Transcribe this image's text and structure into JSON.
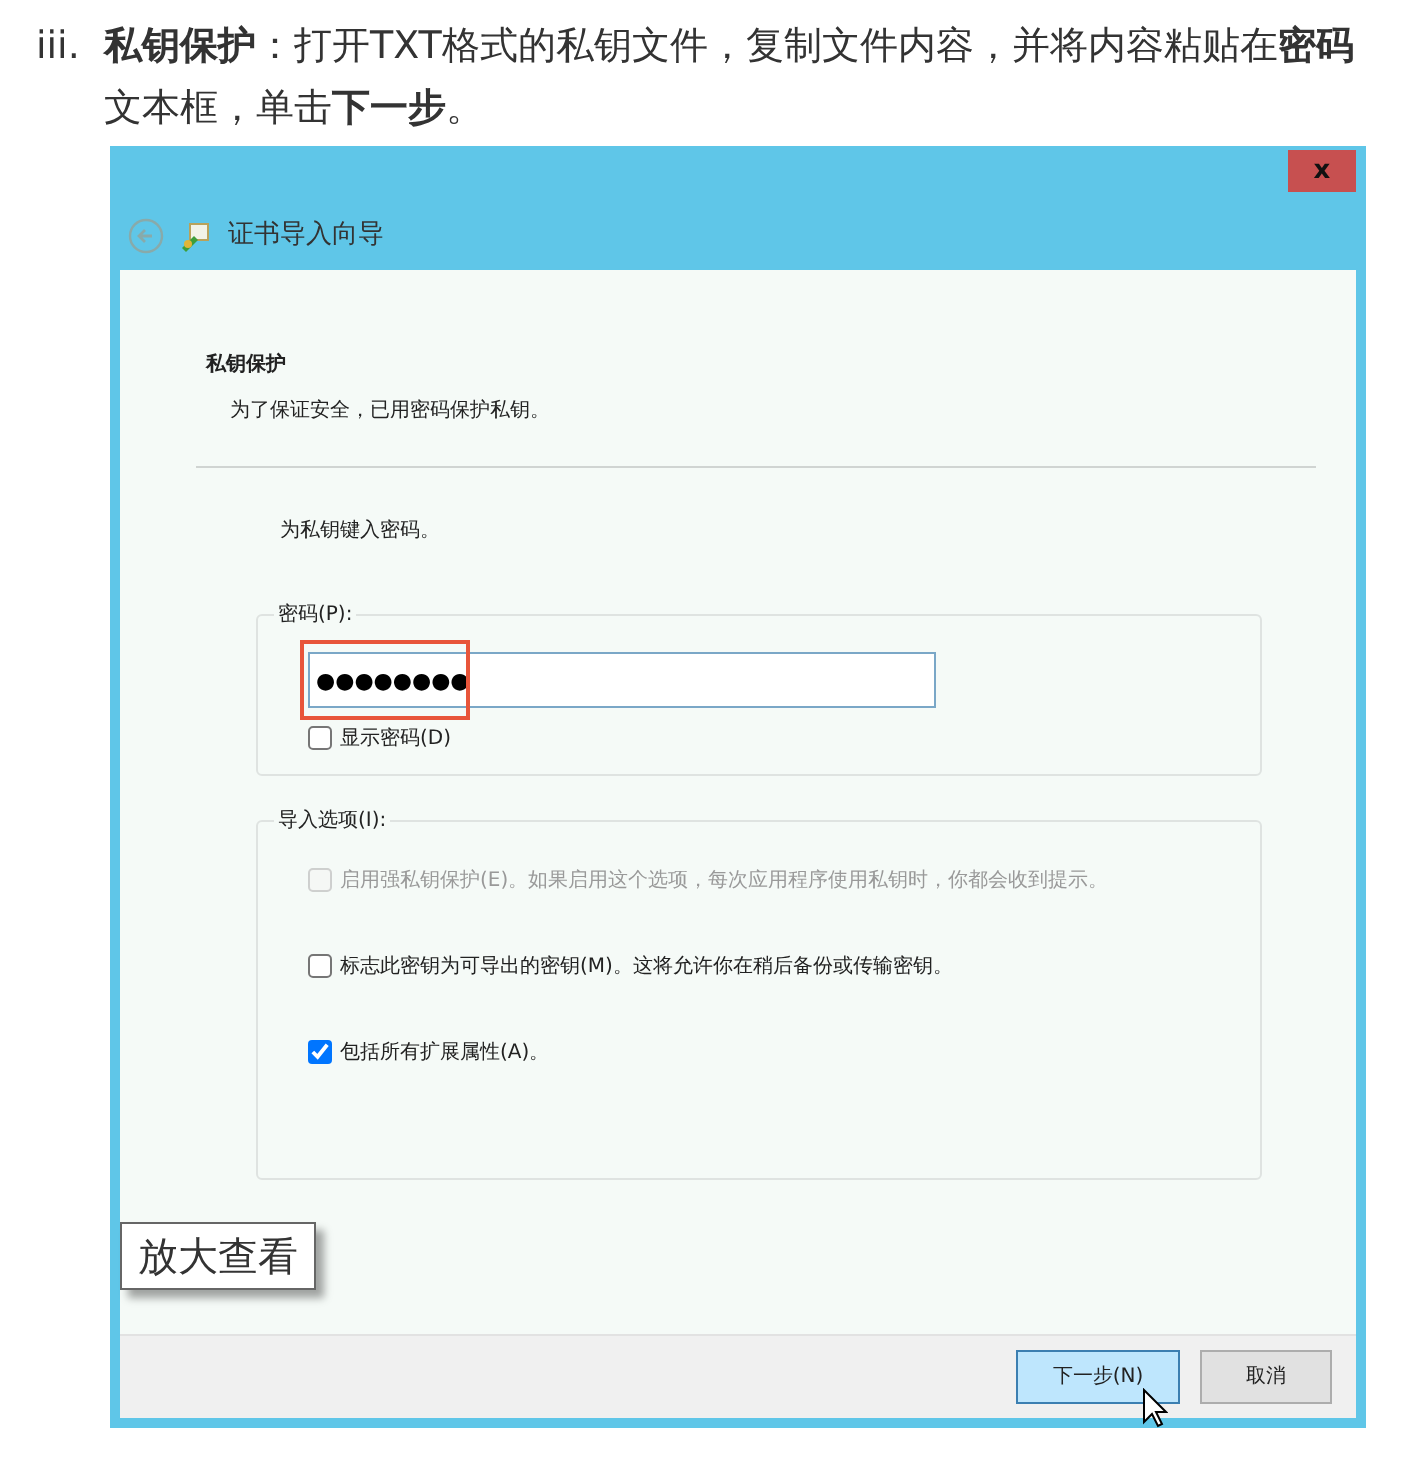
{
  "instruction": {
    "marker": "iii.",
    "text": "**私钥保护**：打开TXT格式的私钥文件，复制文件内容，并将内容粘贴在**密码**文本框，单击**下一步**。"
  },
  "dialog": {
    "close": "x",
    "title": "证书导入向导",
    "heading": "私钥保护",
    "subheading": "为了保证安全，已用密码保护私钥。",
    "prompt": "为私钥键入密码。",
    "password_group": {
      "label": "密码(P):",
      "value": "●●●●●●●●",
      "highlighted": true,
      "show_password": {
        "label": "显示密码(D)",
        "checked": false
      }
    },
    "options_group": {
      "label": "导入选项(I):",
      "options": [
        {
          "label": "启用强私钥保护(E)。如果启用这个选项，每次应用程序使用私钥时，你都会收到提示。",
          "checked": false,
          "disabled": true
        },
        {
          "label": "标志此密钥为可导出的密钥(M)。这将允许你在稍后备份或传输密钥。",
          "checked": false,
          "disabled": false
        },
        {
          "label": "包括所有扩展属性(A)。",
          "checked": true,
          "disabled": false
        }
      ]
    },
    "buttons": [
      {
        "label": "下一步(N)",
        "focused": true
      },
      {
        "label": "取消",
        "focused": false
      }
    ]
  },
  "zoom_button": {
    "label": "放大查看"
  }
}
